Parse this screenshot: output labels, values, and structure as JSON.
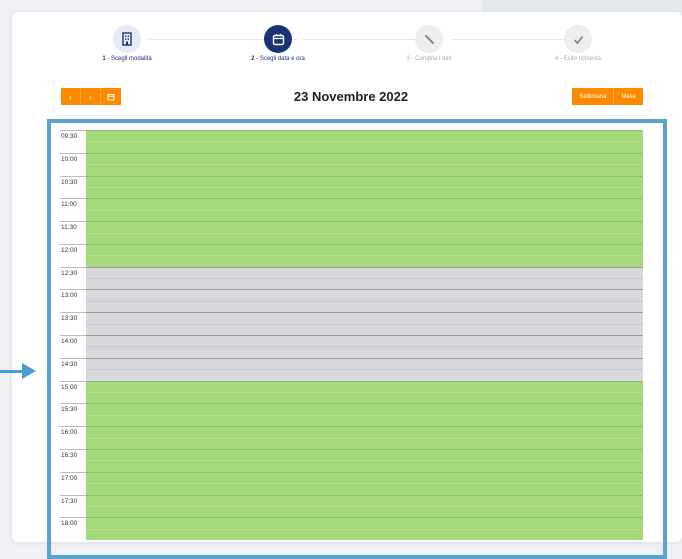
{
  "stepper": {
    "steps": [
      {
        "number": "1",
        "label": "Scegli modalità",
        "state": "done"
      },
      {
        "number": "2",
        "label": "Scegli data e ora",
        "state": "active"
      },
      {
        "number": "3",
        "label": "Compila i dati",
        "state": "todo"
      },
      {
        "number": "4",
        "label": "Esito richiesta",
        "state": "todo"
      }
    ]
  },
  "calendar": {
    "title": "23 Novembre 2022",
    "prev_label": "‹",
    "next_label": "›",
    "today_icon": "calendar-icon",
    "view_week": "Settimana",
    "view_month": "Mese",
    "rows": [
      {
        "time": "09:30",
        "status": "available"
      },
      {
        "time": "",
        "status": "available"
      },
      {
        "time": "10:00",
        "status": "available"
      },
      {
        "time": "",
        "status": "available"
      },
      {
        "time": "10:30",
        "status": "available"
      },
      {
        "time": "",
        "status": "available"
      },
      {
        "time": "11:00",
        "status": "available"
      },
      {
        "time": "",
        "status": "available"
      },
      {
        "time": "11:30",
        "status": "available"
      },
      {
        "time": "",
        "status": "available"
      },
      {
        "time": "12:00",
        "status": "available"
      },
      {
        "time": "",
        "status": "available"
      },
      {
        "time": "12:30",
        "status": "unavailable"
      },
      {
        "time": "",
        "status": "unavailable"
      },
      {
        "time": "13:00",
        "status": "unavailable"
      },
      {
        "time": "",
        "status": "unavailable"
      },
      {
        "time": "13:30",
        "status": "unavailable"
      },
      {
        "time": "",
        "status": "unavailable"
      },
      {
        "time": "14:00",
        "status": "unavailable"
      },
      {
        "time": "",
        "status": "unavailable"
      },
      {
        "time": "14:30",
        "status": "unavailable"
      },
      {
        "time": "",
        "status": "unavailable"
      },
      {
        "time": "15:00",
        "status": "available"
      },
      {
        "time": "",
        "status": "available"
      },
      {
        "time": "15:30",
        "status": "available"
      },
      {
        "time": "",
        "status": "available"
      },
      {
        "time": "16:00",
        "status": "available"
      },
      {
        "time": "",
        "status": "available"
      },
      {
        "time": "16:30",
        "status": "available"
      },
      {
        "time": "",
        "status": "available"
      },
      {
        "time": "17:00",
        "status": "available"
      },
      {
        "time": "",
        "status": "available"
      },
      {
        "time": "17:30",
        "status": "available"
      },
      {
        "time": "",
        "status": "available"
      },
      {
        "time": "18:00",
        "status": "available"
      },
      {
        "time": "",
        "status": "available"
      }
    ]
  },
  "colors": {
    "accent_orange": "#ff8a00",
    "navy": "#1a3372",
    "available_green": "#a5d77b",
    "unavailable_gray": "#d7d8dc",
    "highlight_blue": "#5aa3cf"
  }
}
